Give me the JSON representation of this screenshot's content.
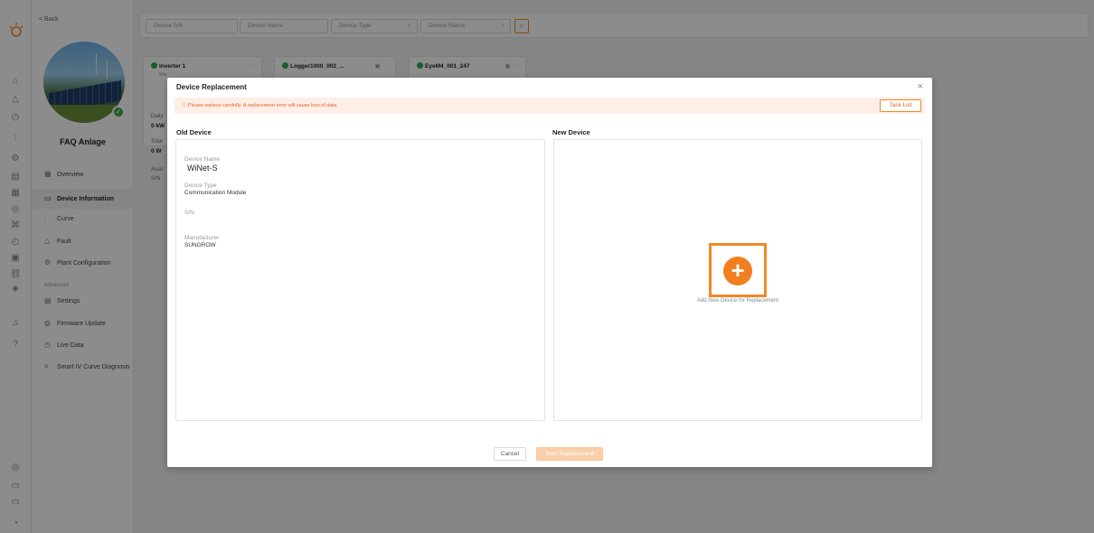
{
  "sidebar": {
    "back_label": "< Back",
    "plant_name": "FAQ Anlage",
    "nav": [
      {
        "label": "Overview",
        "icon": "grid-icon"
      },
      {
        "label": "Device Information",
        "icon": "device-icon"
      },
      {
        "label": "Curve",
        "icon": "chart-icon"
      },
      {
        "label": "Fault",
        "icon": "warning-icon"
      },
      {
        "label": "Plant Configuration",
        "icon": "gear-icon"
      }
    ],
    "advanced_label": "Advanced",
    "advanced_nav": [
      {
        "label": "Settings",
        "icon": "settings-icon"
      },
      {
        "label": "Firmware Update",
        "icon": "firmware-icon"
      },
      {
        "label": "Live Data",
        "icon": "clock-icon"
      },
      {
        "label": "Smart IV Curve Diagnosis",
        "icon": "scan-icon"
      }
    ]
  },
  "filters": {
    "sn_placeholder": "Device S/N",
    "name_placeholder": "Device Name",
    "type_placeholder": "Device Type",
    "status_placeholder": "Device Status"
  },
  "devices": [
    {
      "name": "Inverter 1",
      "sub": "Inv"
    },
    {
      "name": "Logger1000_002_...",
      "sub": ""
    },
    {
      "name": "EyeM4_001_247",
      "sub": ""
    }
  ],
  "device_stats": {
    "daily_label": "Daily",
    "daily_value": "0 kW",
    "total_label": "Total",
    "total_value": "0 W",
    "assoc_label": "Asso",
    "sn_label": "S/N"
  },
  "modal": {
    "title": "Device Replacement",
    "warning": "Please replace carefully. A replacement error will cause loss of data.",
    "task_list": "Task List",
    "old_title": "Old Device",
    "new_title": "New Device",
    "old": {
      "name_label": "Device Name",
      "name_value": "WiNet-S",
      "type_label": "Device Type",
      "type_value": "Communication Module",
      "sn_label": "S/N",
      "manufacturer_label": "Manufacturer",
      "manufacturer_value": "SUNGROW"
    },
    "add_label": "Add New Device for Replacement",
    "cancel": "Cancel",
    "start": "Start Replacement"
  },
  "colors": {
    "accent": "#f17f1f",
    "warning_bg": "#fdeee6",
    "online": "#2fa84f"
  }
}
